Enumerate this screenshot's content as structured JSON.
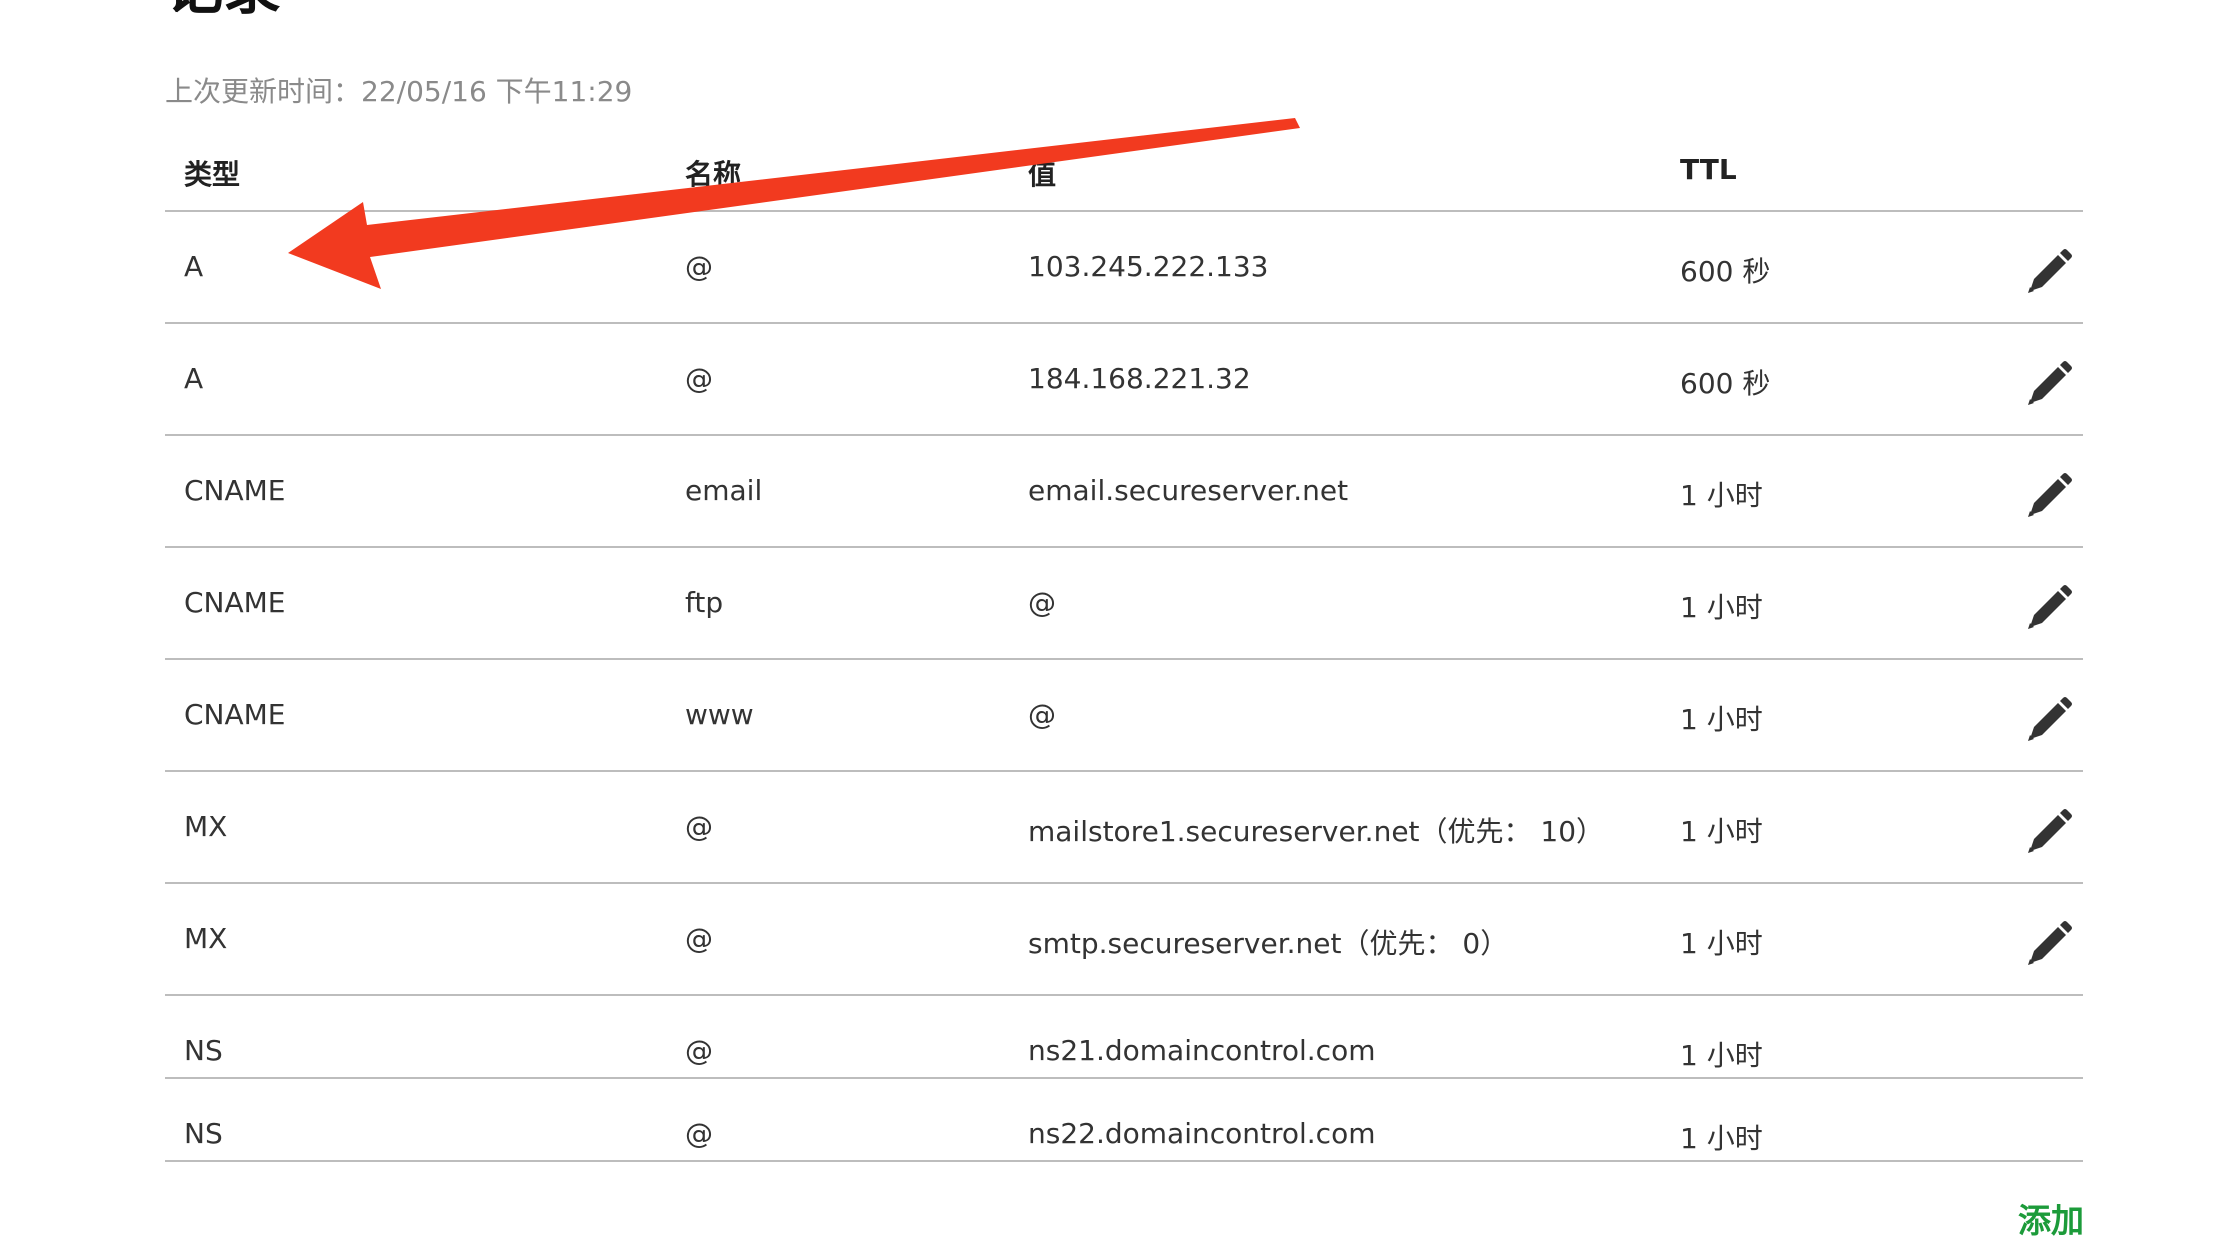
{
  "page": {
    "title": "记录",
    "last_updated": "上次更新时间：22/05/16 下午11:29",
    "add_label": "添加"
  },
  "table": {
    "columns": [
      "类型",
      "名称",
      "值",
      "TTL"
    ],
    "rows": [
      {
        "type": "A",
        "name": "@",
        "value": "103.245.222.133",
        "ttl": "600 秒",
        "editable": true
      },
      {
        "type": "A",
        "name": "@",
        "value": "184.168.221.32",
        "ttl": "600 秒",
        "editable": true
      },
      {
        "type": "CNAME",
        "name": "email",
        "value": "email.secureserver.net",
        "ttl": "1 小时",
        "editable": true
      },
      {
        "type": "CNAME",
        "name": "ftp",
        "value": "@",
        "ttl": "1 小时",
        "editable": true
      },
      {
        "type": "CNAME",
        "name": "www",
        "value": "@",
        "ttl": "1 小时",
        "editable": true
      },
      {
        "type": "MX",
        "name": "@",
        "value": "mailstore1.secureserver.net（优先： 10）",
        "ttl": "1 小时",
        "editable": true
      },
      {
        "type": "MX",
        "name": "@",
        "value": "smtp.secureserver.net（优先： 0）",
        "ttl": "1 小时",
        "editable": true
      },
      {
        "type": "NS",
        "name": "@",
        "value": "ns21.domaincontrol.com",
        "ttl": "1 小时",
        "editable": false
      },
      {
        "type": "NS",
        "name": "@",
        "value": "ns22.domaincontrol.com",
        "ttl": "1 小时",
        "editable": false
      }
    ]
  },
  "icons": {
    "edit": "pencil-icon",
    "annotation": "red-arrow"
  },
  "colors": {
    "add_link": "#1c9b3a",
    "annotation_arrow": "#f23a1f",
    "divider": "#bdbdbd",
    "muted_text": "#8a8a8a"
  }
}
